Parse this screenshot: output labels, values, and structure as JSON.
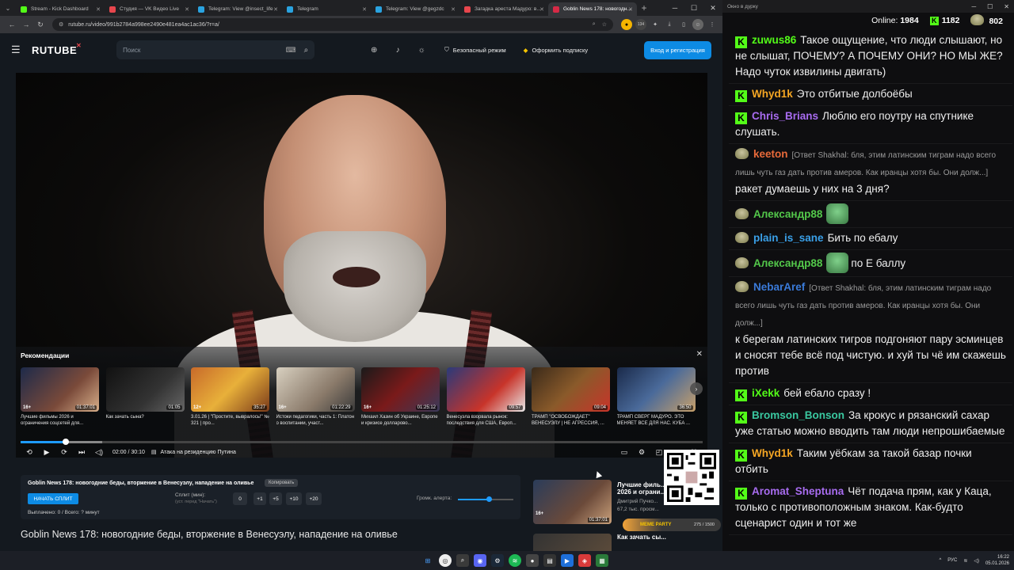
{
  "browser": {
    "tabs": [
      {
        "label": "Stream - Kick Dashboard",
        "color": "#53fc18",
        "active": false
      },
      {
        "label": "Студия — VK Видео Live",
        "color": "#e8464d",
        "active": false
      },
      {
        "label": "Telegram: View @insect_life",
        "color": "#2aa3e0",
        "active": false
      },
      {
        "label": "Telegram",
        "color": "#2aa3e0",
        "active": false
      },
      {
        "label": "Telegram: View @gegzdc",
        "color": "#2aa3e0",
        "active": false
      },
      {
        "label": "Загадка ареста Мадуро: в...",
        "color": "#e8464d",
        "active": false
      },
      {
        "label": "Goblin News 178: новогодн...",
        "color": "#d62a46",
        "active": true
      }
    ],
    "url": "rutube.ru/video/991b2784a998ee2490e481ea4ac1ac36/?r=a/",
    "ext_badge": "134"
  },
  "header": {
    "logo": "RUTUBE",
    "search_placeholder": "Поиск",
    "safe_mode": "Безопасный режим",
    "subscribe": "Оформить подписку",
    "login": "Вход и регистрация"
  },
  "player": {
    "reco_title": "Рекомендации",
    "reco": [
      {
        "title": "Лучшие фильмы 2026 и ограничения соцсетей для...",
        "age": "16+",
        "dur": "01:37:01",
        "bg": "linear-gradient(135deg,#1d2a4a,#7a4a3a 60%,#d8b08a)"
      },
      {
        "title": "Как зачать сына?",
        "age": "",
        "dur": "01:05",
        "bg": "linear-gradient(135deg,#111,#333 60%,#666)"
      },
      {
        "title": "3.01.26 | \"Простите, вывралось!\" № 321 | про...",
        "age": "12+",
        "dur": "35:27",
        "bg": "linear-gradient(135deg,#c86a2a,#e8b03a 50%,#7a3a1a)"
      },
      {
        "title": "Истоки педагогики, часть 1: Платон о воспитании, участ...",
        "age": "16+",
        "dur": "01:22:29",
        "bg": "linear-gradient(135deg,#d8d0c0,#8a7a6a 60%,#3a3a3a)"
      },
      {
        "title": "Михаил Хазин об Украине, Европе и кризисе долларово...",
        "age": "16+",
        "dur": "01:25:12",
        "bg": "linear-gradient(135deg,#1a1a1a,#7a1a1a 50%,#3a3a5a)"
      },
      {
        "title": "Венесуэла взорвала рынок: последствия для США, Европ...",
        "age": "",
        "dur": "09:57",
        "bg": "linear-gradient(135deg,#2a3a7a,#c8342a 60%,#e8e8e8)"
      },
      {
        "title": "ТРАМП \"ОСВОБОЖДАЕТ\" ВЕНЕСУЭЛУ | НЕ АГРЕССИЯ, ...",
        "age": "",
        "dur": "09:04",
        "bg": "linear-gradient(135deg,#3a2a1a,#8a5a2a 50%,#c8342a)"
      },
      {
        "title": "ТРАМП СВЕРГ МАДУРО. ЭТО МЕНЯЕТ ВСЕ ДЛЯ НАС. КУБА ...",
        "age": "",
        "dur": "36:50",
        "bg": "linear-gradient(135deg,#1a2a4a,#4a6a9a 50%,#c8a06a)"
      }
    ],
    "progress": 0.066,
    "buffered": 0.12,
    "time": "02:00 / 30:10",
    "chapter": "Атака на резиденцию Путина"
  },
  "split": {
    "title": "Goblin News 178: новогодние беды, вторжение в Венесуэлу, нападение на оливье",
    "copy": "Копировать",
    "start": "НАЧАТЬ СПЛИТ",
    "split_label": "Сплит (мин):",
    "split_sub": "(уст. перед \"Начать\")",
    "buttons": [
      "0",
      "+1",
      "+5",
      "+10",
      "+20"
    ],
    "volume_label": "Громк. алерта:",
    "volume": 0.55,
    "stats": "Выплачено: 0 / Всего: ? минут"
  },
  "video_title": "Goblin News 178: новогодние беды, вторжение в Венесуэлу, нападение на оливье",
  "side": {
    "title": "Лучшие филь... 2026 и ограни...",
    "author": "Дмитрий Пучко...",
    "views": "67,2 тыс. просм...",
    "age": "16+",
    "dur": "01:37:01",
    "title2": "Как зачать сы..."
  },
  "meme": {
    "label": "MEME PARTY",
    "count": "275 / 1500"
  },
  "chat": {
    "window_title": "Окно в дурку",
    "online_label": "Online:",
    "online": "1984",
    "followers": "1182",
    "subs": "802",
    "messages": [
      {
        "badge": "k",
        "nick": "zuwus86",
        "color": "#53fc18",
        "reply": "",
        "emote": false,
        "text": "Такое ощущение, что люди слышают, но не слышат, ПОЧЕМУ? А ПОЧЕМУ ОНИ? НО МЫ ЖЕ? Надо чуток извилины двигать)"
      },
      {
        "badge": "k",
        "nick": "Whyd1k",
        "color": "#f5a623",
        "reply": "",
        "emote": false,
        "text": "Это отбитые долбоёбы"
      },
      {
        "badge": "k",
        "nick": "Chris_Brians",
        "color": "#a86cf0",
        "reply": "",
        "emote": false,
        "text": "Люблю его поутру на спутнике слушать."
      },
      {
        "badge": "p",
        "nick": "keeton",
        "color": "#e86a3a",
        "reply": "[Ответ Shakhal: бля, этим латинским тиграм надо всего лишь чуть газ дать против амеров. Как иранцы хотя бы. Они долж...]",
        "emote": false,
        "text": "ракет думаешь у них на 3 дня?"
      },
      {
        "badge": "p",
        "nick": "Александр88",
        "color": "#53c84a",
        "reply": "",
        "emote": true,
        "text": ""
      },
      {
        "badge": "p",
        "nick": "plain_is_sane",
        "color": "#3aa0e8",
        "reply": "",
        "emote": false,
        "text": "Бить по ебалу"
      },
      {
        "badge": "p",
        "nick": "Александр88",
        "color": "#53c84a",
        "reply": "",
        "emote": true,
        "text": "по Е баллу"
      },
      {
        "badge": "p",
        "nick": "NebarAref",
        "color": "#3a7ad8",
        "reply": "[Ответ Shakhal: бля, этим латинским тиграм надо всего лишь чуть газ дать против амеров. Как иранцы хотя бы. Они долж...]",
        "emote": false,
        "text": "к берегам латинских тигров подгоняют пару эсминцев и сносят тебе всё под чистую. и хуй ты чё им скажешь против"
      },
      {
        "badge": "k",
        "nick": "iXekk",
        "color": "#53fc18",
        "reply": "",
        "emote": false,
        "text": "бей ебало сразу !"
      },
      {
        "badge": "k",
        "nick": "Bromson_Bonson",
        "color": "#3ac8a0",
        "reply": "",
        "emote": false,
        "text": "За крокус и рязанский сахар уже статью можно вводить там люди непрошибаемые"
      },
      {
        "badge": "k",
        "nick": "Whyd1k",
        "color": "#f5a623",
        "reply": "",
        "emote": false,
        "text": "Таким уёбкам за такой базар почки отбить"
      },
      {
        "badge": "k",
        "nick": "Aromat_Sheptuna",
        "color": "#a86cf0",
        "reply": "",
        "emote": false,
        "text": "Чёт подача прям, как у Каца, только с противоположным знаком. Как-будто сценарист один и тот же"
      }
    ]
  },
  "taskbar": {
    "lang": "РУС",
    "time": "16:22",
    "date": "05.01.2026"
  }
}
